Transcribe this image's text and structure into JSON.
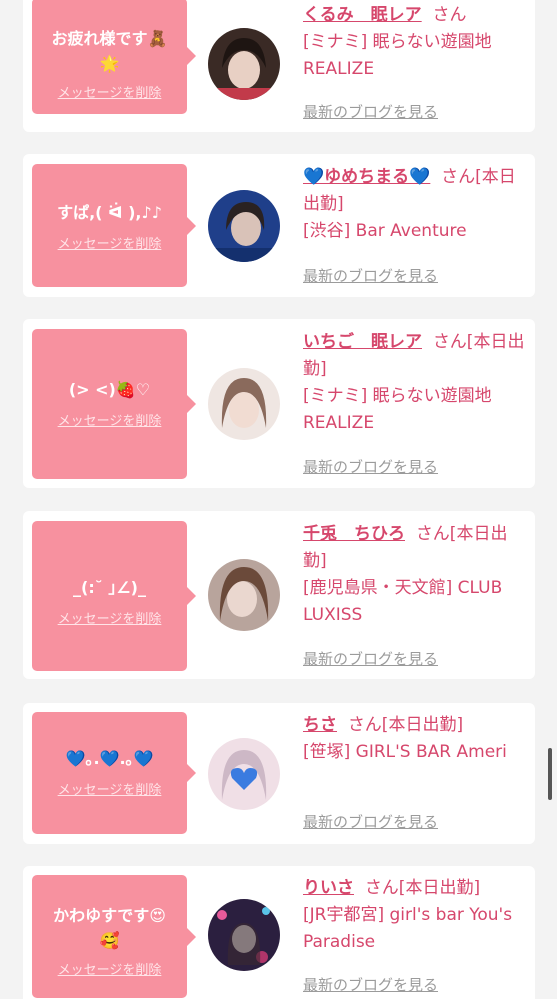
{
  "cards": [
    {
      "message": "お疲れ様です🧸\n🌟",
      "delete_label": "メッセージを削除",
      "name": "くるみ　眠レア",
      "suffix": "さん",
      "shop": "[ミナミ] 眠らない遊園地REALIZE",
      "blog_label": "最新のブログを見る",
      "avatar_colors": [
        "#3a2a25",
        "#e8d0c4"
      ]
    },
    {
      "message": "すぱ,( ᐛ ),♪♪",
      "delete_label": "メッセージを削除",
      "name": "💙ゆめちまる💙",
      "suffix": "さん[本日出勤]",
      "shop": "[渋谷] Bar Aventure",
      "blog_label": "最新のブログを見る",
      "avatar_colors": [
        "#1f3f8a",
        "#d9c2b8"
      ]
    },
    {
      "message": "(> <)🍓♡",
      "delete_label": "メッセージを削除",
      "name": "いちご　眠レア",
      "suffix": "さん[本日出勤]",
      "shop": "[ミナミ] 眠らない遊園地REALIZE",
      "blog_label": "最新のブログを見る",
      "avatar_colors": [
        "#c7a99a",
        "#f1dcd2"
      ]
    },
    {
      "message": "_(:˘ ｣∠)_",
      "delete_label": "メッセージを削除",
      "name": "千兎　ちひろ",
      "suffix": "さん[本日出勤]",
      "shop": "[鹿児島県・天文館] CLUB LUXISS",
      "blog_label": "最新のブログを見る",
      "avatar_colors": [
        "#6b4a3a",
        "#ead7cf"
      ]
    },
    {
      "message": "💙｡.💙.｡💙",
      "delete_label": "メッセージを削除",
      "name": "ちさ",
      "suffix": "さん[本日出勤]",
      "shop": "[笹塚] GIRL'S BAR Ameri",
      "blog_label": "最新のブログを見る",
      "avatar_colors": [
        "#f0dfe6",
        "#cdb8c6"
      ]
    },
    {
      "message": "かわゆすです😍\n🥰",
      "delete_label": "メッセージを削除",
      "name": "りいさ",
      "suffix": "さん[本日出勤]",
      "shop": "[JR宇都宮] girl's bar You's Paradise",
      "blog_label": "最新のブログを見る",
      "avatar_colors": [
        "#2b1f3f",
        "#b0356a"
      ]
    }
  ]
}
